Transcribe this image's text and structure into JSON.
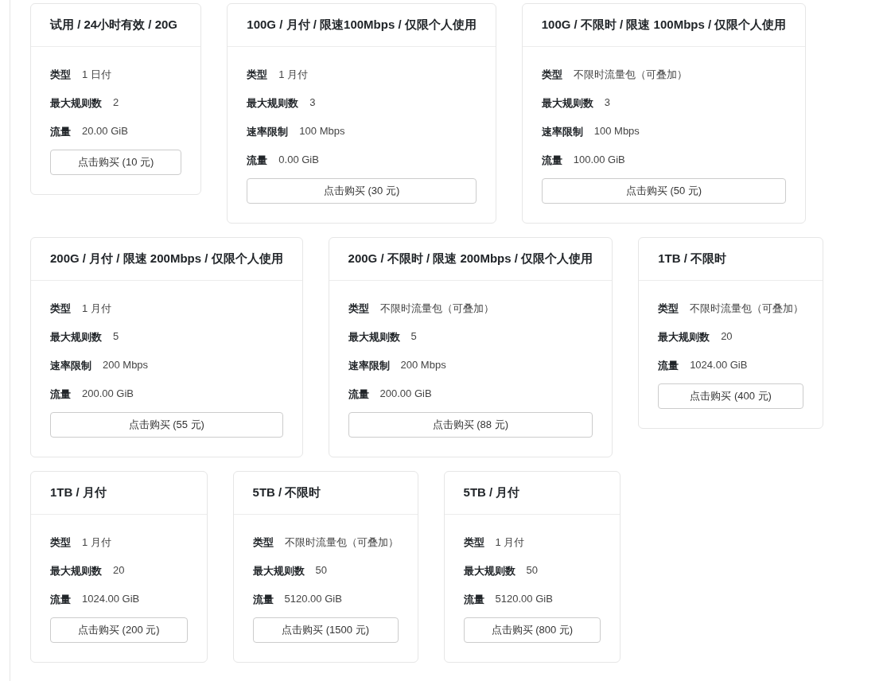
{
  "plans": [
    {
      "title": "试用 / 24小时有效 / 20G",
      "specs": [
        {
          "label": "类型",
          "value": "1 日付"
        },
        {
          "label": "最大规则数",
          "value": "2"
        },
        {
          "label": "流量",
          "value": "20.00 GiB"
        }
      ],
      "button": "点击购买 (10 元)"
    },
    {
      "title": "100G / 月付 / 限速100Mbps / 仅限个人使用",
      "specs": [
        {
          "label": "类型",
          "value": "1 月付"
        },
        {
          "label": "最大规则数",
          "value": "3"
        },
        {
          "label": "速率限制",
          "value": "100 Mbps"
        },
        {
          "label": "流量",
          "value": "0.00 GiB"
        }
      ],
      "button": "点击购买 (30 元)"
    },
    {
      "title": "100G / 不限时 / 限速 100Mbps / 仅限个人使用",
      "specs": [
        {
          "label": "类型",
          "value": "不限时流量包（可叠加）"
        },
        {
          "label": "最大规则数",
          "value": "3"
        },
        {
          "label": "速率限制",
          "value": "100 Mbps"
        },
        {
          "label": "流量",
          "value": "100.00 GiB"
        }
      ],
      "button": "点击购买 (50 元)"
    },
    {
      "title": "200G / 月付 / 限速 200Mbps / 仅限个人使用",
      "specs": [
        {
          "label": "类型",
          "value": "1 月付"
        },
        {
          "label": "最大规则数",
          "value": "5"
        },
        {
          "label": "速率限制",
          "value": "200 Mbps"
        },
        {
          "label": "流量",
          "value": "200.00 GiB"
        }
      ],
      "button": "点击购买 (55 元)"
    },
    {
      "title": "200G / 不限时 / 限速 200Mbps / 仅限个人使用",
      "specs": [
        {
          "label": "类型",
          "value": "不限时流量包（可叠加）"
        },
        {
          "label": "最大规则数",
          "value": "5"
        },
        {
          "label": "速率限制",
          "value": "200 Mbps"
        },
        {
          "label": "流量",
          "value": "200.00 GiB"
        }
      ],
      "button": "点击购买 (88 元)"
    },
    {
      "title": "1TB / 不限时",
      "specs": [
        {
          "label": "类型",
          "value": "不限时流量包（可叠加）"
        },
        {
          "label": "最大规则数",
          "value": "20"
        },
        {
          "label": "流量",
          "value": "1024.00 GiB"
        }
      ],
      "button": "点击购买 (400 元)"
    },
    {
      "title": "1TB / 月付",
      "specs": [
        {
          "label": "类型",
          "value": "1 月付"
        },
        {
          "label": "最大规则数",
          "value": "20"
        },
        {
          "label": "流量",
          "value": "1024.00 GiB"
        }
      ],
      "button": "点击购买 (200 元)"
    },
    {
      "title": "5TB / 不限时",
      "specs": [
        {
          "label": "类型",
          "value": "不限时流量包（可叠加）"
        },
        {
          "label": "最大规则数",
          "value": "50"
        },
        {
          "label": "流量",
          "value": "5120.00 GiB"
        }
      ],
      "button": "点击购买 (1500 元)"
    },
    {
      "title": "5TB / 月付",
      "specs": [
        {
          "label": "类型",
          "value": "1 月付"
        },
        {
          "label": "最大规则数",
          "value": "50"
        },
        {
          "label": "流量",
          "value": "5120.00 GiB"
        }
      ],
      "button": "点击购买 (800 元)"
    }
  ]
}
